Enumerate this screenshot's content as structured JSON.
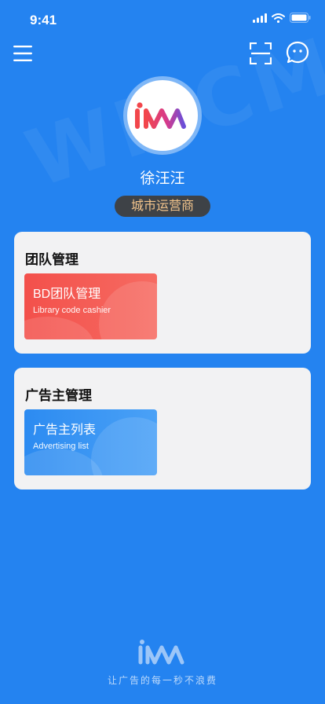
{
  "status_bar": {
    "time": "9:41"
  },
  "watermark": "WMCM",
  "profile": {
    "name": "徐汪汪",
    "role": "城市运营商"
  },
  "team_section": {
    "title": "团队管理",
    "tile": {
      "title": "BD团队管理",
      "subtitle": "Library code cashier"
    }
  },
  "ads_section": {
    "title": "广告主管理",
    "tile": {
      "title": "广告主列表",
      "subtitle": "Advertising list"
    }
  },
  "footer": {
    "slogan": "让广告的每一秒不浪费"
  },
  "icons": [
    "menu-icon",
    "scan-icon",
    "chat-icon",
    "signal-icon",
    "wifi-icon",
    "battery-icon"
  ],
  "colors": {
    "background": "#2483f0",
    "badge_bg": "#3e4247",
    "badge_text": "#f4c58c",
    "tile_red": "#f3504b",
    "tile_blue": "#2c8bf1"
  }
}
